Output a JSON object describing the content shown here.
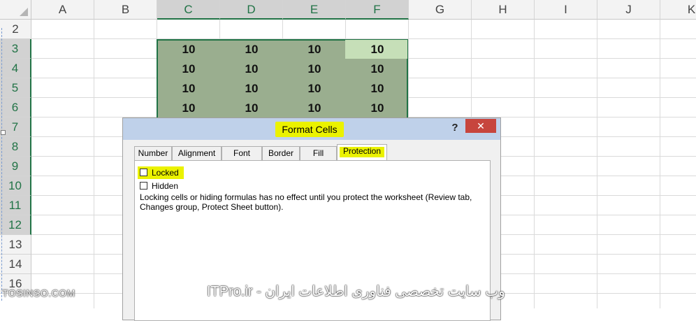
{
  "columns": [
    "A",
    "B",
    "C",
    "D",
    "E",
    "F",
    "G",
    "H",
    "I",
    "J",
    "K"
  ],
  "selected_columns": [
    "C",
    "D",
    "E",
    "F"
  ],
  "rows": [
    "2",
    "3",
    "4",
    "5",
    "6",
    "7",
    "8",
    "9",
    "10",
    "11",
    "12",
    "13",
    "14",
    "16"
  ],
  "selected_rows": [
    "3",
    "4",
    "5",
    "6",
    "7",
    "8",
    "9",
    "10",
    "11",
    "12"
  ],
  "cells": [
    [
      "10",
      "10",
      "10",
      "10"
    ],
    [
      "10",
      "10",
      "10",
      "10"
    ],
    [
      "10",
      "10",
      "10",
      "10"
    ],
    [
      "10",
      "10",
      "10",
      "10"
    ]
  ],
  "dialog": {
    "title": "Format Cells",
    "help": "?",
    "close": "✕",
    "tabs": [
      "Number",
      "Alignment",
      "Font",
      "Border",
      "Fill",
      "Protection"
    ],
    "active_tab": "Protection",
    "locked_label": "Locked",
    "locked_checked": false,
    "hidden_label": "Hidden",
    "hidden_checked": false,
    "info_text": "Locking cells or hiding formulas has no effect until you protect the worksheet (Review tab, Changes group, Protect Sheet button)."
  },
  "watermark_left": "TOSINSO.COM",
  "watermark_right": "ITPro.ir - وب سایت تخصصی فناوری اطلاعات ایران",
  "colors": {
    "selection_fill": "#9aae8f",
    "selection_border": "#217346",
    "active_cell": "#c6dfb8",
    "highlight": "#ebf200",
    "title_bar": "#bfd1ea",
    "close_button": "#c7453d"
  }
}
